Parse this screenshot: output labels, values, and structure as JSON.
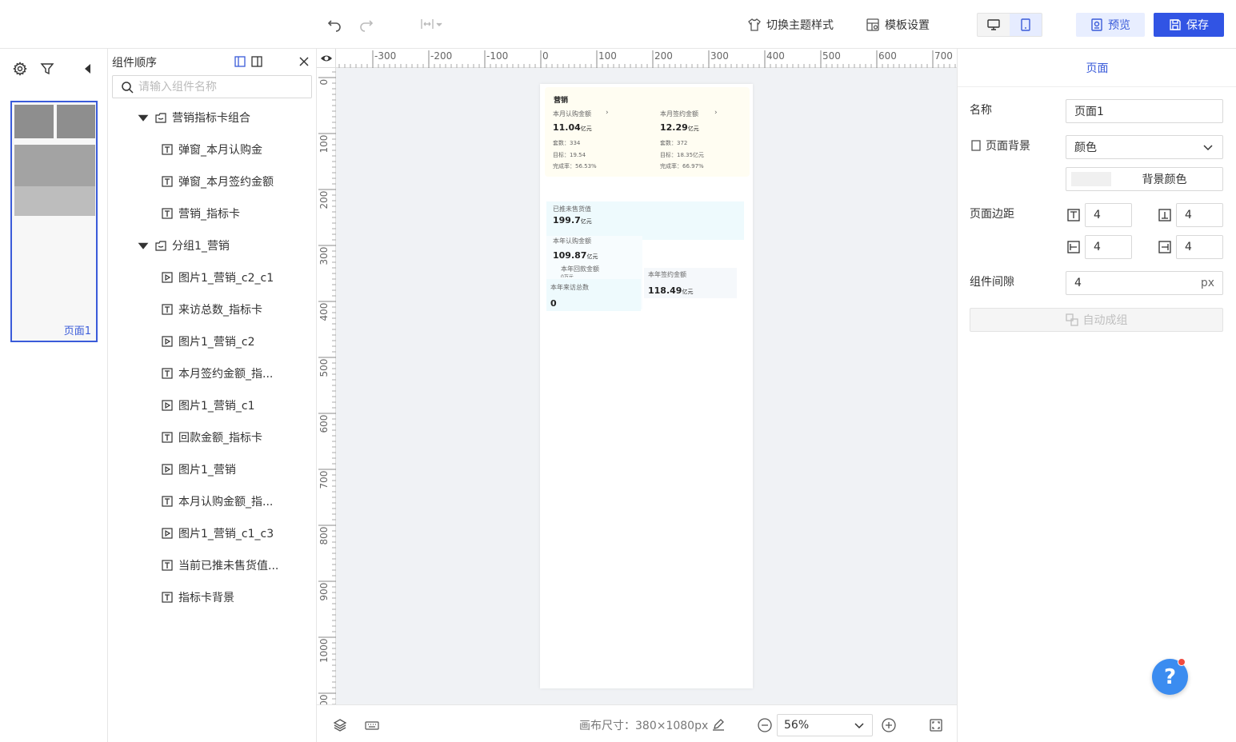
{
  "toolbar": {
    "theme_label": "切换主题样式",
    "template_label": "模板设置",
    "preview_label": "预览",
    "save_label": "保存",
    "accent_color": "#3154e4"
  },
  "pages": {
    "thumb_label": "页面1"
  },
  "tree": {
    "title": "组件顺序",
    "search_placeholder": "请输入组件名称",
    "items": [
      {
        "label": "营销指标卡组合",
        "type": "group"
      },
      {
        "label": "弹窗_本月认购金",
        "type": "text"
      },
      {
        "label": "弹窗_本月签约金额",
        "type": "text"
      },
      {
        "label": "营销_指标卡",
        "type": "text"
      },
      {
        "label": "分组1_营销",
        "type": "group"
      },
      {
        "label": "图片1_营销_c2_c1",
        "type": "image"
      },
      {
        "label": "来访总数_指标卡",
        "type": "text"
      },
      {
        "label": "图片1_营销_c2",
        "type": "image"
      },
      {
        "label": "本月签约金额_指...",
        "type": "text"
      },
      {
        "label": "图片1_营销_c1",
        "type": "image"
      },
      {
        "label": "回款金额_指标卡",
        "type": "text"
      },
      {
        "label": "图片1_营销",
        "type": "image"
      },
      {
        "label": "本月认购金额_指...",
        "type": "text"
      },
      {
        "label": "图片1_营销_c1_c3",
        "type": "image"
      },
      {
        "label": "当前已推未售货值...",
        "type": "text"
      },
      {
        "label": "指标卡背景",
        "type": "text"
      }
    ]
  },
  "ruler": {
    "top": [
      "-300",
      "-200",
      "-100",
      "0",
      "100",
      "200",
      "300",
      "400",
      "500",
      "600",
      "700"
    ],
    "left": [
      "0",
      "100",
      "200",
      "300",
      "400",
      "500",
      "600",
      "700",
      "800",
      "900",
      "1000",
      "1100"
    ]
  },
  "artboard": {
    "section_title": "营销",
    "card1": {
      "title": "本月认购金额",
      "value": "11.04",
      "unit": "亿元",
      "sets": "套数：334",
      "target": "目标：19.54",
      "rate": "完成率：56.53%"
    },
    "card2": {
      "title": "本月签约金额",
      "value": "12.29",
      "unit": "亿元",
      "sets": "套数：372",
      "target": "目标：18.35亿元",
      "rate": "完成率：66.97%"
    },
    "unsold": {
      "title": "已推未售货值",
      "value": "199.7",
      "unit": "亿元"
    },
    "year_sub": {
      "title": "本年认购金额",
      "value": "109.87",
      "unit": "亿元"
    },
    "payback": {
      "title": "本年回款金额",
      "value": "0",
      "unit": "万元"
    },
    "visits": {
      "title": "本年来访总数",
      "value": "0"
    },
    "year_sign": {
      "title": "本年签约金额",
      "value": "118.49",
      "unit": "亿元"
    }
  },
  "bottombar": {
    "canvas_size": "画布尺寸：380×1080px",
    "zoom": "56%"
  },
  "props": {
    "tab": "页面",
    "name_label": "名称",
    "name_value": "页面1",
    "bg_label": "页面背景",
    "bg_select": "颜色",
    "bg_color_label": "背景颜色",
    "margin_label": "页面边距",
    "margin_top": "4",
    "margin_bottom": "4",
    "margin_left": "4",
    "margin_right": "4",
    "gap_label": "组件间隙",
    "gap_value": "4",
    "gap_unit": "px",
    "auto_group": "自动成组"
  },
  "help": {
    "label": "?"
  }
}
